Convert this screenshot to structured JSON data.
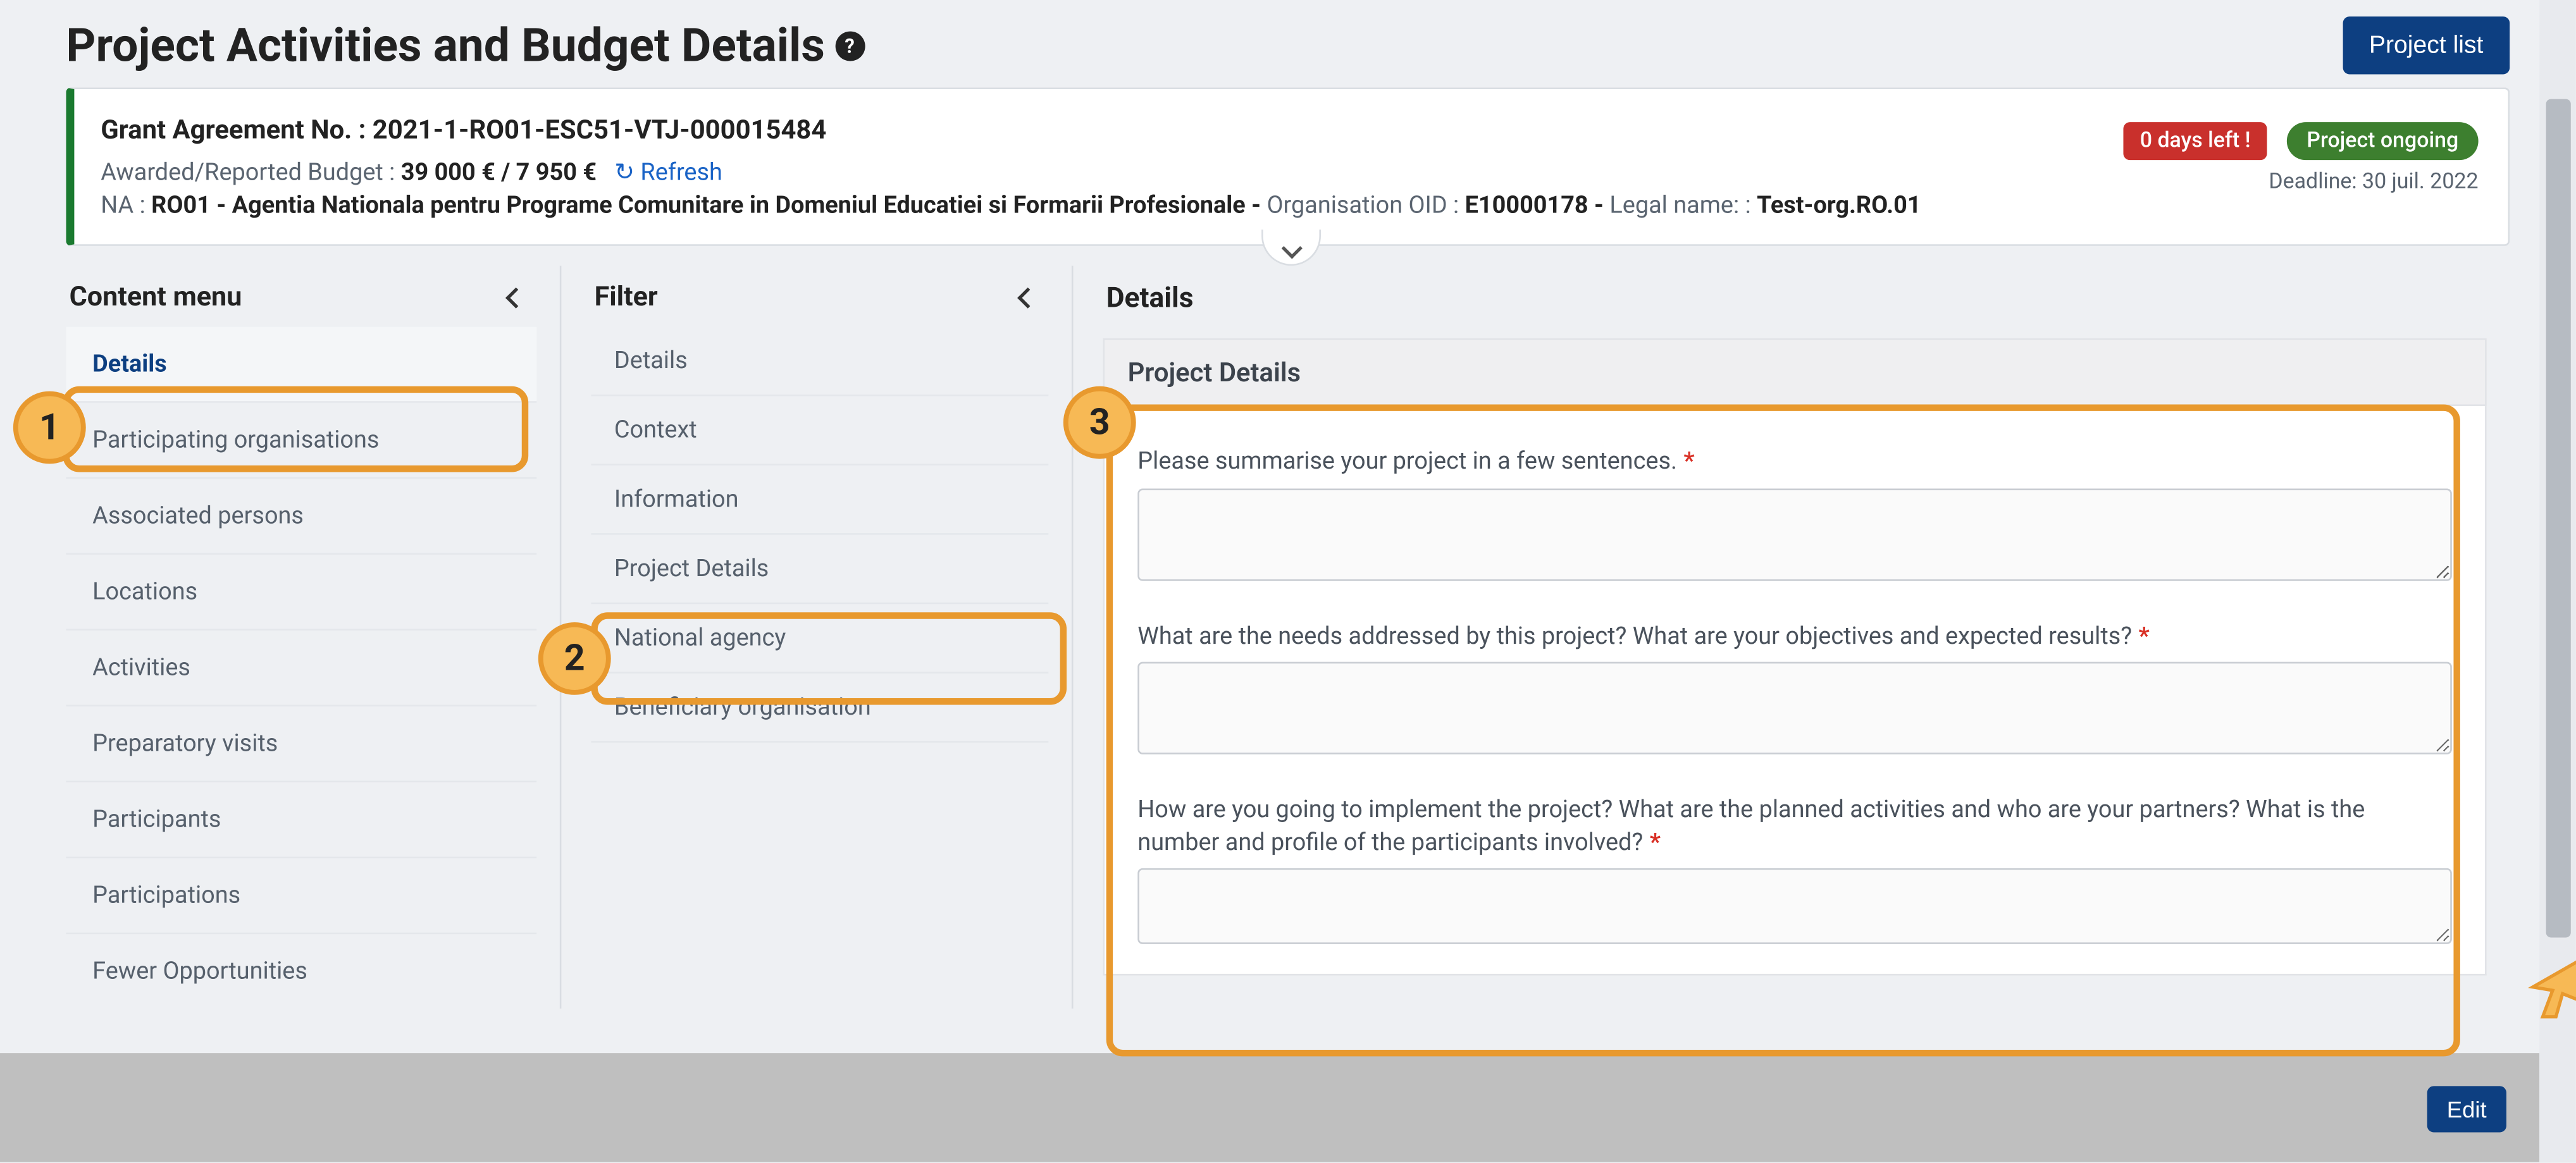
{
  "header": {
    "title": "Project Activities and Budget Details",
    "project_list_button": "Project list"
  },
  "info": {
    "grant_label": "Grant Agreement No. : ",
    "grant_no": "2021-1-RO01-ESC51-VTJ-000015484",
    "budget_label": "Awarded/Reported Budget : ",
    "budget_value": "39 000 € / 7 950 €",
    "refresh": "Refresh",
    "na_label": "NA : ",
    "na_value": "RO01 - Agentia Nationala pentru Programe Comunitare in Domeniul Educatiei si Formarii Profesionale - ",
    "oid_label": "Organisation OID : ",
    "oid_value": "E10000178 - ",
    "legal_label": "Legal name: : ",
    "legal_value": "Test-org.RO.01",
    "days_left": "0 days left !",
    "status": "Project ongoing",
    "deadline": "Deadline: 30 juil. 2022"
  },
  "content_menu": {
    "title": "Content menu",
    "items": [
      "Details",
      "Participating organisations",
      "Associated persons",
      "Locations",
      "Activities",
      "Preparatory visits",
      "Participants",
      "Participations",
      "Fewer Opportunities"
    ]
  },
  "filter_menu": {
    "title": "Filter",
    "items": [
      "Details",
      "Context",
      "Information",
      "Project Details",
      "National agency",
      "Beneficiary organisation"
    ]
  },
  "details": {
    "pane_title": "Details",
    "section_title": "Project Details",
    "q1": "Please summarise your project in a few sentences.",
    "q2": "What are the needs addressed by this project? What are your objectives and expected results?",
    "q3": "How are you going to implement the project? What are the planned activities and who are your partners? What is the number and profile of the participants involved?",
    "a1": "",
    "a2": "",
    "a3": ""
  },
  "footer": {
    "edit": "Edit"
  },
  "annotations": {
    "n1": "1",
    "n2": "2",
    "n3": "3"
  }
}
